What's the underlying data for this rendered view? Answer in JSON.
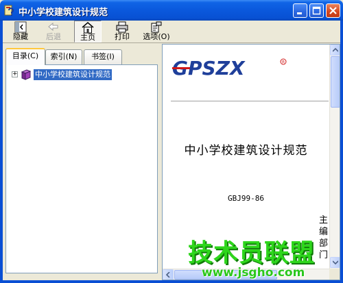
{
  "window": {
    "title": "中小学校建筑设计规范"
  },
  "toolbar": {
    "hide_label": "隐藏",
    "back_label": "后退",
    "home_label": "主页",
    "print_label": "打印",
    "options_label": "选项(O)"
  },
  "tabs": [
    {
      "label": "目录(C)",
      "active": true
    },
    {
      "label": "索引(N)",
      "active": false
    },
    {
      "label": "书签(I)",
      "active": false
    }
  ],
  "tree": {
    "items": [
      {
        "label": "中小学校建筑设计规范",
        "selected": true
      }
    ]
  },
  "document": {
    "logo_text": "GPSZX",
    "title": "中小学校建筑设计规范",
    "code": "GBJ99-86",
    "editor_chars": [
      "主",
      "编",
      "部",
      "门"
    ]
  },
  "watermark": {
    "text": "技术员联盟",
    "url": "www.jsgho.com"
  },
  "colors": {
    "titlebar": "#0a58dc",
    "selection": "#316ac5",
    "logo_blue": "#1f3f9a",
    "logo_red": "#d01818",
    "watermark_green": "#2ed61c"
  }
}
